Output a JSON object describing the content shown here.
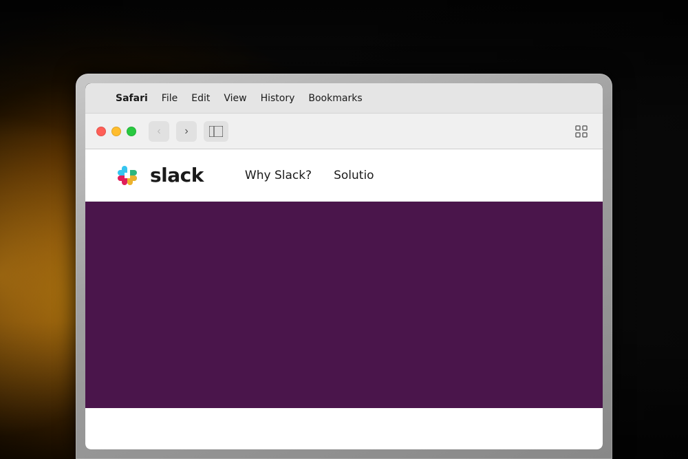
{
  "scene": {
    "background": "ambient bokeh lamp light"
  },
  "menubar": {
    "apple_icon": "",
    "items": [
      {
        "label": "Safari",
        "bold": true
      },
      {
        "label": "File",
        "bold": false
      },
      {
        "label": "Edit",
        "bold": false
      },
      {
        "label": "View",
        "bold": false
      },
      {
        "label": "History",
        "bold": false
      },
      {
        "label": "Bookmarks",
        "bold": false
      }
    ]
  },
  "toolbar": {
    "back_label": "‹",
    "forward_label": "›",
    "sidebar_icon": "⊡",
    "grid_icon": "⠿"
  },
  "slack_nav": {
    "logo_text": "slack",
    "nav_links": [
      {
        "label": "Why Slack?"
      },
      {
        "label": "Solutio"
      }
    ]
  },
  "slack_hero": {
    "background_color": "#4a154b"
  }
}
